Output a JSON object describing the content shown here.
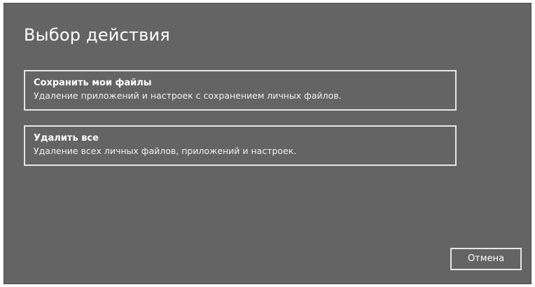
{
  "dialog": {
    "title": "Выбор действия",
    "options": [
      {
        "title": "Сохранить мои файлы",
        "description": "Удаление приложений и настроек с сохранением личных файлов."
      },
      {
        "title": "Удалить все",
        "description": "Удаление всех личных файлов, приложений и настроек."
      }
    ],
    "cancel_label": "Отмена"
  },
  "colors": {
    "background": "#646464",
    "border": "#e6e6e6",
    "text": "#ffffff"
  }
}
